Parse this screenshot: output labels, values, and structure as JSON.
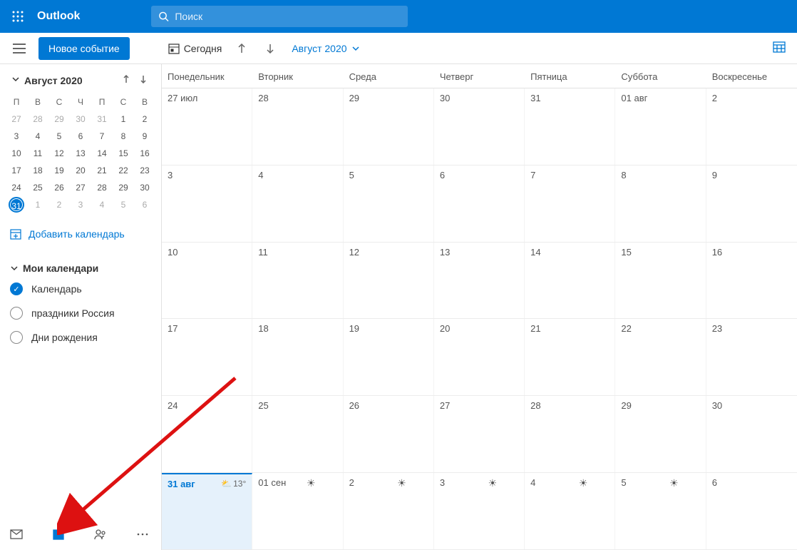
{
  "header": {
    "app_title": "Outlook",
    "search_placeholder": "Поиск"
  },
  "toolbar": {
    "new_event": "Новое событие",
    "today": "Сегодня",
    "month_label": "Август 2020"
  },
  "mini_calendar": {
    "title": "Август 2020",
    "day_headers": [
      "П",
      "В",
      "С",
      "Ч",
      "П",
      "С",
      "В"
    ],
    "days": [
      {
        "n": "27",
        "dim": true
      },
      {
        "n": "28",
        "dim": true
      },
      {
        "n": "29",
        "dim": true
      },
      {
        "n": "30",
        "dim": true
      },
      {
        "n": "31",
        "dim": true
      },
      {
        "n": "1"
      },
      {
        "n": "2"
      },
      {
        "n": "3"
      },
      {
        "n": "4"
      },
      {
        "n": "5"
      },
      {
        "n": "6"
      },
      {
        "n": "7"
      },
      {
        "n": "8"
      },
      {
        "n": "9"
      },
      {
        "n": "10"
      },
      {
        "n": "11"
      },
      {
        "n": "12"
      },
      {
        "n": "13"
      },
      {
        "n": "14"
      },
      {
        "n": "15"
      },
      {
        "n": "16"
      },
      {
        "n": "17"
      },
      {
        "n": "18"
      },
      {
        "n": "19"
      },
      {
        "n": "20"
      },
      {
        "n": "21"
      },
      {
        "n": "22"
      },
      {
        "n": "23"
      },
      {
        "n": "24"
      },
      {
        "n": "25"
      },
      {
        "n": "26"
      },
      {
        "n": "27"
      },
      {
        "n": "28"
      },
      {
        "n": "29"
      },
      {
        "n": "30"
      },
      {
        "n": "31",
        "today": true
      },
      {
        "n": "1",
        "dim": true
      },
      {
        "n": "2",
        "dim": true
      },
      {
        "n": "3",
        "dim": true
      },
      {
        "n": "4",
        "dim": true
      },
      {
        "n": "5",
        "dim": true
      },
      {
        "n": "6",
        "dim": true
      }
    ]
  },
  "sidebar": {
    "add_calendar": "Добавить календарь",
    "my_calendars": "Мои календари",
    "calendars": [
      {
        "label": "Календарь",
        "checked": true
      },
      {
        "label": "праздники Россия",
        "checked": false
      },
      {
        "label": "Дни рождения",
        "checked": false
      }
    ]
  },
  "month_view": {
    "day_headers": [
      "Понедельник",
      "Вторник",
      "Среда",
      "Четверг",
      "Пятница",
      "Суббота",
      "Воскресенье"
    ],
    "weeks": [
      [
        {
          "label": "27 июл"
        },
        {
          "label": "28"
        },
        {
          "label": "29"
        },
        {
          "label": "30"
        },
        {
          "label": "31"
        },
        {
          "label": "01 авг"
        },
        {
          "label": "2"
        }
      ],
      [
        {
          "label": "3"
        },
        {
          "label": "4"
        },
        {
          "label": "5"
        },
        {
          "label": "6"
        },
        {
          "label": "7"
        },
        {
          "label": "8"
        },
        {
          "label": "9"
        }
      ],
      [
        {
          "label": "10"
        },
        {
          "label": "11"
        },
        {
          "label": "12"
        },
        {
          "label": "13"
        },
        {
          "label": "14"
        },
        {
          "label": "15"
        },
        {
          "label": "16"
        }
      ],
      [
        {
          "label": "17"
        },
        {
          "label": "18"
        },
        {
          "label": "19"
        },
        {
          "label": "20"
        },
        {
          "label": "21"
        },
        {
          "label": "22"
        },
        {
          "label": "23"
        }
      ],
      [
        {
          "label": "24"
        },
        {
          "label": "25"
        },
        {
          "label": "26"
        },
        {
          "label": "27"
        },
        {
          "label": "28"
        },
        {
          "label": "29"
        },
        {
          "label": "30"
        }
      ],
      [
        {
          "label": "31 авг",
          "today": true,
          "weather": "13°",
          "weather_icon": "cloud"
        },
        {
          "label": "01 сен",
          "sun": true
        },
        {
          "label": "2",
          "sun": true
        },
        {
          "label": "3",
          "sun": true
        },
        {
          "label": "4",
          "sun": true
        },
        {
          "label": "5",
          "sun": true
        },
        {
          "label": "6"
        }
      ]
    ]
  }
}
